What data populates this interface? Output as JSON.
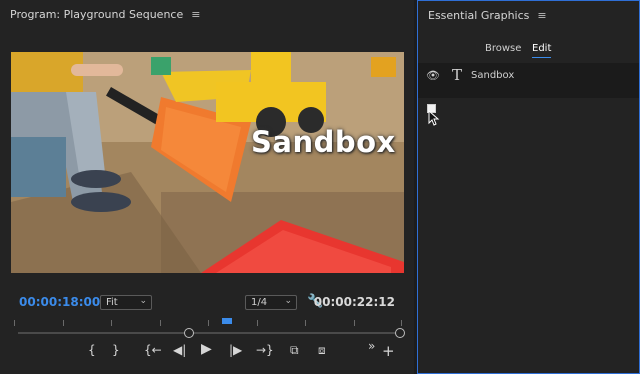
{
  "program_panel": {
    "title": "Program: Playground Sequence",
    "menu_icon": "hamburger-menu-icon"
  },
  "video": {
    "overlay_text": "Sandbox"
  },
  "timecode": {
    "current": "00:00:18:00",
    "duration": "00:00:22:12"
  },
  "zoom_select": {
    "value": "Fit"
  },
  "resolution_select": {
    "value": "1/4"
  },
  "controls": {
    "mark_in": "{",
    "mark_out": "}",
    "go_to_in": "{←",
    "step_back": "◀|",
    "play": "▶",
    "step_forward": "|▶",
    "go_to_out": "→}",
    "insert": "⧉",
    "overwrite": "⧈",
    "more": "»",
    "add": "+"
  },
  "essential_graphics": {
    "title": "Essential Graphics",
    "menu_icon": "hamburger-menu-icon",
    "tabs": [
      {
        "label": "Browse",
        "active": false
      },
      {
        "label": "Edit",
        "active": true
      }
    ],
    "layers": [
      {
        "name": "Sandbox",
        "icon": "text-layer-icon",
        "visible": true
      }
    ]
  },
  "colors": {
    "accent": "#3b8bea",
    "panel_bg": "#232323",
    "focus_border": "#2f6fd6"
  }
}
